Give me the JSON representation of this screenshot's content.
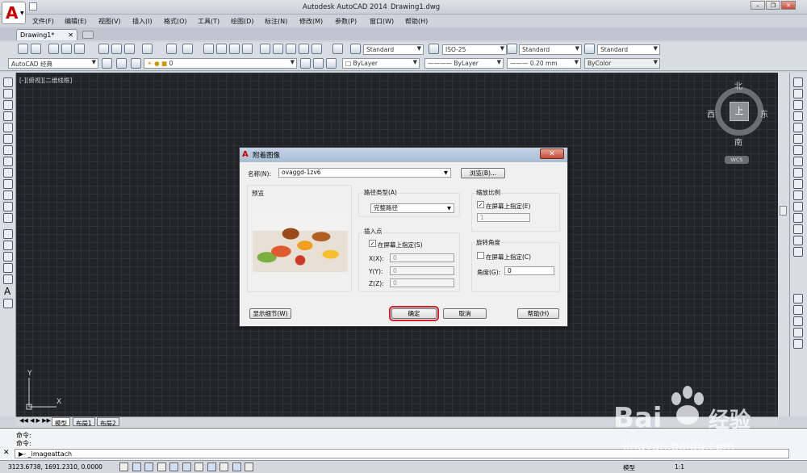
{
  "window": {
    "app_title": "Autodesk AutoCAD 2014",
    "doc_title": "Drawing1.dwg"
  },
  "menu": [
    "文件(F)",
    "编辑(E)",
    "视图(V)",
    "插入(I)",
    "格式(O)",
    "工具(T)",
    "绘图(D)",
    "标注(N)",
    "修改(M)",
    "参数(P)",
    "窗口(W)",
    "帮助(H)"
  ],
  "tabs": {
    "drawing": "Drawing1*"
  },
  "toolbar": {
    "text_style": "Standard",
    "dim_style": "ISO-25",
    "table_style": "Standard",
    "mleader_style": "Standard",
    "workspace": "AutoCAD 经典",
    "layer": "0",
    "color": "ByLayer",
    "linetype": "ByLayer",
    "lineweight": "0.20 mm",
    "plotstyle": "ByColor"
  },
  "viewport": {
    "label": "[-][俯视][二维线框]"
  },
  "viewcube": {
    "north": "北",
    "south": "南",
    "east": "东",
    "west": "西",
    "top": "上",
    "wcs": "WCS"
  },
  "ucs": {
    "x": "X",
    "y": "Y"
  },
  "layout_tabs": [
    "模型",
    "布局1",
    "布局2"
  ],
  "command": {
    "line1": "命令:",
    "line2": "命令:",
    "input": "_imageattach"
  },
  "status": {
    "coords": "3123.6738, 1691.2310, 0.0000",
    "model": "模型",
    "scale": "1:1"
  },
  "dialog": {
    "title": "附着图像",
    "name_label": "名称(N):",
    "name_value": "ovaggd-1zv6",
    "browse": "浏览(B)...",
    "preview_label": "预览",
    "path_type_label": "路径类型(A)",
    "path_type_value": "完整路径",
    "insert_point_label": "插入点",
    "insert_onscreen": "在屏幕上指定(S)",
    "x_label": "X(X):",
    "x_value": "0",
    "y_label": "Y(Y):",
    "y_value": "0",
    "z_label": "Z(Z):",
    "z_value": "0",
    "scale_label": "缩放比例",
    "scale_onscreen": "在屏幕上指定(E)",
    "scale_value": "1",
    "rotation_label": "旋转角度",
    "rotation_onscreen": "在屏幕上指定(C)",
    "angle_label": "角度(G):",
    "angle_value": "0",
    "details": "显示细节(W)",
    "ok": "确定",
    "cancel": "取消",
    "help": "帮助(H)"
  },
  "watermark": {
    "brand": "Bai",
    "brand2": "经验",
    "url": "jingyan.baidu.com"
  }
}
